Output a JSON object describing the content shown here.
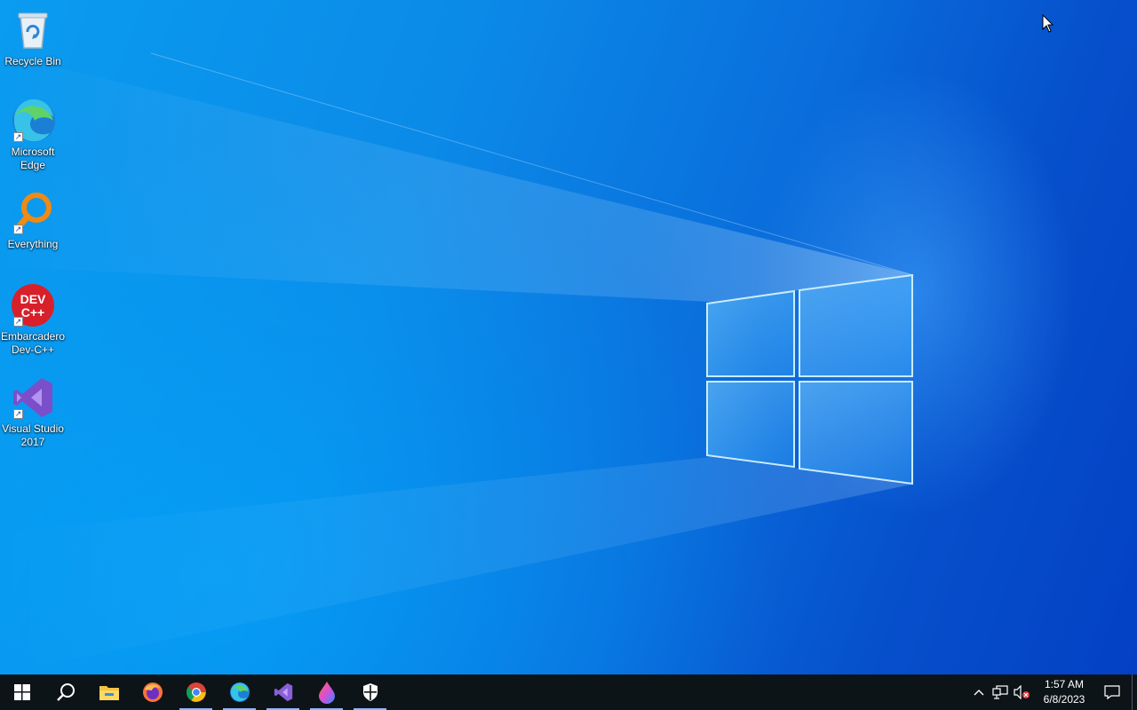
{
  "desktop": {
    "icons": [
      {
        "label": "Recycle Bin"
      },
      {
        "label": "Microsoft Edge"
      },
      {
        "label": "Everything"
      },
      {
        "label": "Embarcadero Dev-C++"
      },
      {
        "label": "Visual Studio 2017"
      }
    ]
  },
  "taskbar": {
    "items": [
      {
        "icon": "windows-start-icon"
      },
      {
        "icon": "search-icon"
      },
      {
        "icon": "file-explorer-icon"
      },
      {
        "icon": "firefox-icon"
      },
      {
        "icon": "chrome-icon"
      },
      {
        "icon": "edge-icon"
      },
      {
        "icon": "visual-studio-icon"
      },
      {
        "icon": "paint-drop-icon"
      },
      {
        "icon": "security-shield-icon"
      }
    ],
    "tray": {
      "time": "1:57 AM",
      "date": "6/8/2023"
    }
  },
  "colors": {
    "accent": "#0a78e0",
    "taskbar": "#0c1418"
  }
}
